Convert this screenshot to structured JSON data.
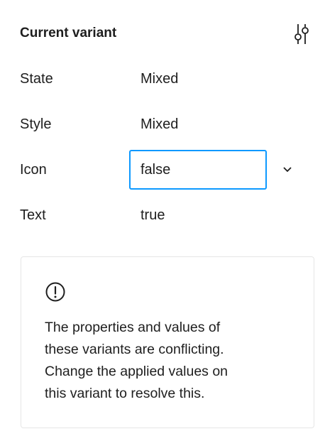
{
  "panel": {
    "title": "Current variant",
    "settings_icon": "adjust-sliders-icon"
  },
  "properties": [
    {
      "label": "State",
      "value": "Mixed"
    },
    {
      "label": "Style",
      "value": "Mixed"
    },
    {
      "label": "Icon",
      "value": "false",
      "editable": true
    },
    {
      "label": "Text",
      "value": "true"
    }
  ],
  "warning": {
    "icon": "alert-circle-icon",
    "lines": [
      "The properties and values of",
      "these variants are conflicting.",
      "Change the applied values on",
      "this variant to resolve this."
    ]
  },
  "colors": {
    "focus": "#0d99ff",
    "text": "#1e1e1e",
    "border": "#e6e6e6"
  }
}
